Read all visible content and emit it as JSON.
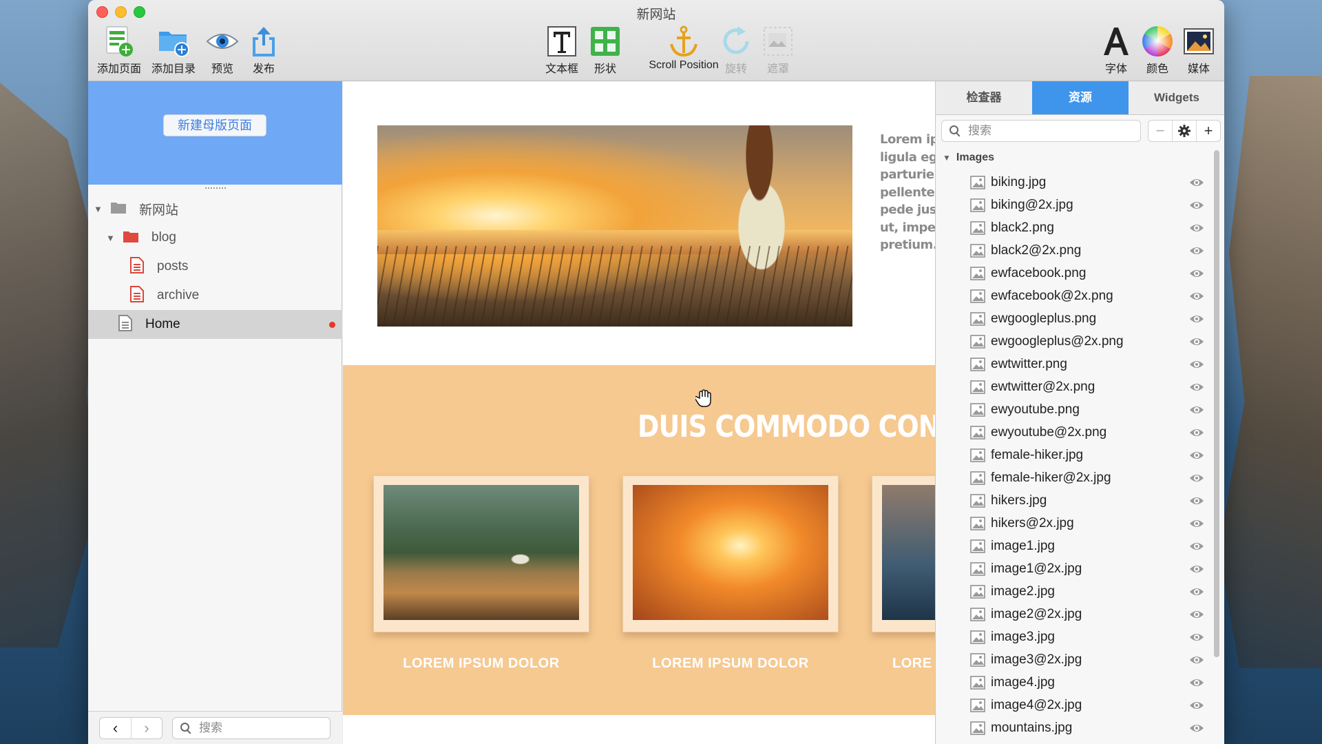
{
  "window": {
    "title": "新网站"
  },
  "toolbar": {
    "left": [
      {
        "label": "添加页面",
        "icon": "add-page-icon"
      },
      {
        "label": "添加目录",
        "icon": "add-folder-icon"
      },
      {
        "label": "预览",
        "icon": "preview-eye-icon"
      },
      {
        "label": "发布",
        "icon": "publish-icon"
      }
    ],
    "center": [
      {
        "label": "文本框",
        "icon": "text-box-icon",
        "enabled": true
      },
      {
        "label": "形状",
        "icon": "shapes-icon",
        "enabled": true
      },
      {
        "label": "Scroll Position",
        "icon": "anchor-icon",
        "enabled": true
      },
      {
        "label": "旋转",
        "icon": "rotate-icon",
        "enabled": false
      },
      {
        "label": "遮罩",
        "icon": "mask-icon",
        "enabled": false
      }
    ],
    "right": [
      {
        "label": "字体",
        "icon": "font-icon"
      },
      {
        "label": "颜色",
        "icon": "color-wheel-icon"
      },
      {
        "label": "媒体",
        "icon": "media-icon"
      }
    ]
  },
  "sidebar": {
    "master_button": "新建母版页面",
    "tree": [
      {
        "label": "新网站",
        "type": "site",
        "expanded": true
      },
      {
        "label": "blog",
        "type": "folder",
        "expanded": true
      },
      {
        "label": "posts",
        "type": "page"
      },
      {
        "label": "archive",
        "type": "page"
      },
      {
        "label": "Home",
        "type": "page",
        "selected": true,
        "modified": true
      }
    ],
    "search_placeholder": "搜索"
  },
  "canvas": {
    "side_text": [
      "Lorem ips",
      "ligula eg",
      "parturien",
      "pellentes",
      "pede just",
      "ut, imper",
      "pretium. I"
    ],
    "section_heading": "DUIS COMMODO CONSEQ",
    "cards": [
      {
        "caption": "LOREM IPSUM DOLOR"
      },
      {
        "caption": "LOREM IPSUM DOLOR"
      },
      {
        "caption": "LORE"
      }
    ],
    "section_color": "#f6c991"
  },
  "inspector": {
    "tabs": [
      {
        "label": "检查器",
        "active": false
      },
      {
        "label": "资源",
        "active": true
      },
      {
        "label": "Widgets",
        "active": false
      }
    ],
    "search_placeholder": "搜索",
    "group": "Images",
    "assets": [
      "biking.jpg",
      "biking@2x.jpg",
      "black2.png",
      "black2@2x.png",
      "ewfacebook.png",
      "ewfacebook@2x.png",
      "ewgoogleplus.png",
      "ewgoogleplus@2x.png",
      "ewtwitter.png",
      "ewtwitter@2x.png",
      "ewyoutube.png",
      "ewyoutube@2x.png",
      "female-hiker.jpg",
      "female-hiker@2x.jpg",
      "hikers.jpg",
      "hikers@2x.jpg",
      "image1.jpg",
      "image1@2x.jpg",
      "image2.jpg",
      "image2@2x.jpg",
      "image3.jpg",
      "image3@2x.jpg",
      "image4.jpg",
      "image4@2x.jpg",
      "mountains.jpg"
    ]
  },
  "colors": {
    "accent": "#3f95ec",
    "master_area": "#6fa8f5",
    "modified_dot": "#e8362c"
  }
}
